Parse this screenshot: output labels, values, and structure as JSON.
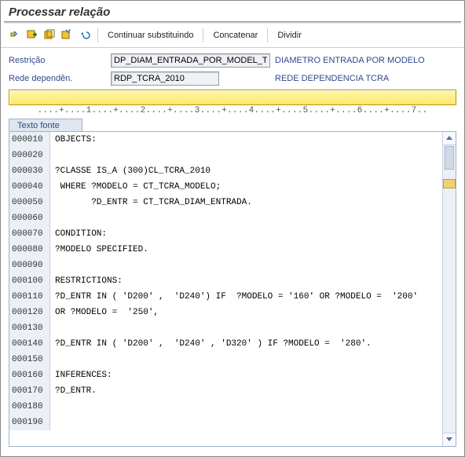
{
  "title": "Processar relação",
  "toolbar": {
    "btn_continue": "Continuar substituindo",
    "btn_concat": "Concatenar",
    "btn_split": "Dividir"
  },
  "form": {
    "restricao_label": "Restrição",
    "restricao_value": "DP_DIAM_ENTRADA_POR_MODEL_TCRA",
    "restricao_desc": "DIAMETRO ENTRADA POR MODELO",
    "rede_label": "Rede dependên.",
    "rede_value": "RDP_TCRA_2010",
    "rede_desc": "REDE DEPENDENCIA TCRA"
  },
  "ruler": "     ....+....1....+....2....+....3....+....4....+....5....+....6....+....7..",
  "section_tab": "Texto fonte",
  "code": [
    {
      "n": "000010",
      "t": "OBJECTS:"
    },
    {
      "n": "000020",
      "t": ""
    },
    {
      "n": "000030",
      "t": "?CLASSE IS_A (300)CL_TCRA_2010"
    },
    {
      "n": "000040",
      "t": " WHERE ?MODELO = CT_TCRA_MODELO;"
    },
    {
      "n": "000050",
      "t": "       ?D_ENTR = CT_TCRA_DIAM_ENTRADA."
    },
    {
      "n": "000060",
      "t": ""
    },
    {
      "n": "000070",
      "t": "CONDITION:"
    },
    {
      "n": "000080",
      "t": "?MODELO SPECIFIED."
    },
    {
      "n": "000090",
      "t": ""
    },
    {
      "n": "000100",
      "t": "RESTRICTIONS:"
    },
    {
      "n": "000110",
      "t": "?D_ENTR IN ( 'D200' ,  'D240') IF  ?MODELO = '160' OR ?MODELO =  '200'"
    },
    {
      "n": "000120",
      "t": "OR ?MODELO =  '250',"
    },
    {
      "n": "000130",
      "t": ""
    },
    {
      "n": "000140",
      "t": "?D_ENTR IN ( 'D200' ,  'D240' , 'D320' ) IF ?MODELO =  '280'."
    },
    {
      "n": "000150",
      "t": ""
    },
    {
      "n": "000160",
      "t": "INFERENCES:"
    },
    {
      "n": "000170",
      "t": "?D_ENTR."
    },
    {
      "n": "000180",
      "t": ""
    },
    {
      "n": "000190",
      "t": ""
    }
  ]
}
